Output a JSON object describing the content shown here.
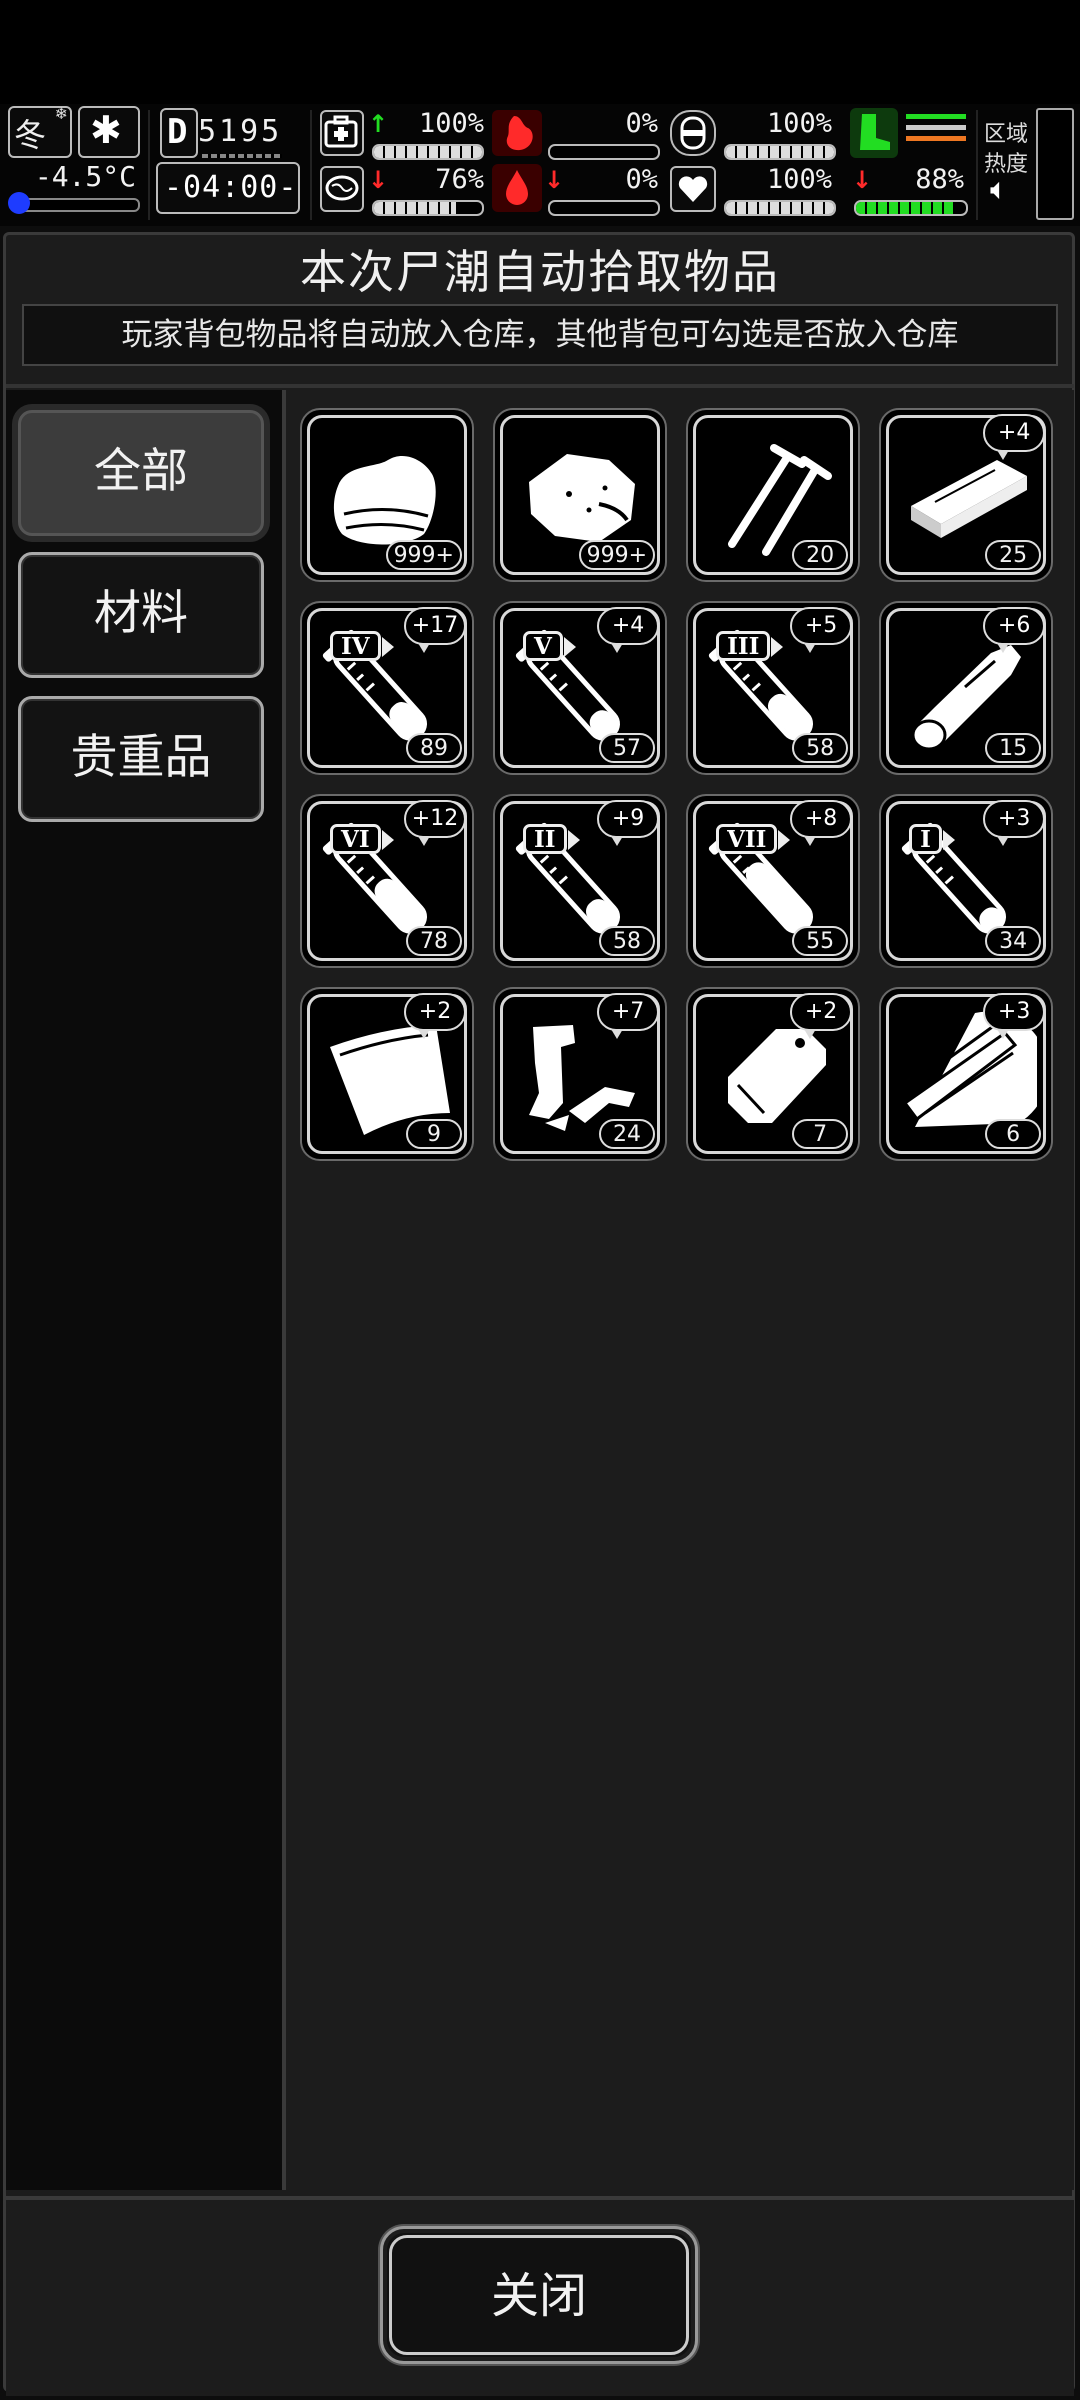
{
  "hud": {
    "season": "冬",
    "temperature": "-4.5°C",
    "day": "5195",
    "day_prefix": "D",
    "time": "-04:00-",
    "stats": [
      {
        "name": "health",
        "value": "100%",
        "trend": "up",
        "level": 1.0
      },
      {
        "name": "hunger",
        "value": "0%",
        "trend": "none",
        "level": 0.0
      },
      {
        "name": "thirst",
        "value": "100%",
        "trend": "none",
        "level": 1.0
      },
      {
        "name": "stamina",
        "value": "100%",
        "trend": "none",
        "level": 1.0
      },
      {
        "name": "sanity",
        "value": "76%",
        "trend": "down",
        "level": 0.76
      },
      {
        "name": "bleeding",
        "value": "0%",
        "trend": "down",
        "level": 0.0
      },
      {
        "name": "mood",
        "value": "100%",
        "trend": "none",
        "level": 1.0
      },
      {
        "name": "energy",
        "value": "88%",
        "trend": "down",
        "level": 0.88
      }
    ],
    "area_heat_label_1": "区域",
    "area_heat_label_2": "热度",
    "accent_green": "#22dd22",
    "accent_red": "#ff2a2a"
  },
  "panel": {
    "title": "本次尸潮自动拾取物品",
    "subtitle": "玩家背包物品将自动放入仓库，其他背包可勾选是否放入仓库"
  },
  "tabs": [
    {
      "label": "全部",
      "active": true
    },
    {
      "label": "材料",
      "active": false
    },
    {
      "label": "贵重品",
      "active": false
    }
  ],
  "items": [
    {
      "icon": "cloth-icon",
      "count": "999+",
      "bonus": ""
    },
    {
      "icon": "meat-icon",
      "count": "999+",
      "bonus": ""
    },
    {
      "icon": "nails-icon",
      "count": "20",
      "bonus": ""
    },
    {
      "icon": "plank-icon",
      "count": "25",
      "bonus": "+4"
    },
    {
      "icon": "vial-iv-icon",
      "roman": "IV",
      "fill": 0.35,
      "count": "89",
      "bonus": "+17"
    },
    {
      "icon": "vial-v-icon",
      "roman": "V",
      "fill": 0.25,
      "count": "57",
      "bonus": "+4"
    },
    {
      "icon": "vial-iii-icon",
      "roman": "III",
      "fill": 0.45,
      "count": "58",
      "bonus": "+5"
    },
    {
      "icon": "bone-icon",
      "count": "15",
      "bonus": "+6"
    },
    {
      "icon": "vial-vi-icon",
      "roman": "VI",
      "fill": 0.55,
      "count": "78",
      "bonus": "+12"
    },
    {
      "icon": "vial-ii-icon",
      "roman": "II",
      "fill": 0.3,
      "count": "58",
      "bonus": "+9"
    },
    {
      "icon": "vial-vii-icon",
      "roman": "VII",
      "fill": 0.75,
      "count": "55",
      "bonus": "+8"
    },
    {
      "icon": "vial-i-icon",
      "roman": "I",
      "fill": 0.2,
      "count": "34",
      "bonus": "+3"
    },
    {
      "icon": "glass-shard-icon",
      "count": "9",
      "bonus": "+2"
    },
    {
      "icon": "scrap-metal-icon",
      "count": "24",
      "bonus": "+7"
    },
    {
      "icon": "metal-plate-icon",
      "count": "7",
      "bonus": "+2"
    },
    {
      "icon": "wood-scraps-icon",
      "count": "6",
      "bonus": "+3"
    }
  ],
  "footer": {
    "close_label": "关闭"
  }
}
